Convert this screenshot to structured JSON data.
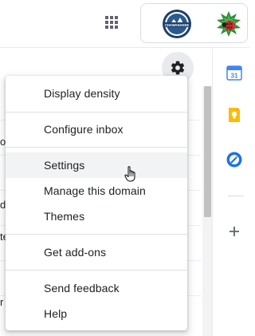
{
  "header": {
    "apps_icon": "apps-grid-icon",
    "org_logo_icon": "organization-logo",
    "org_logo_text": "CHAWANAKEE",
    "avatar_icon": "ladybug-avatar"
  },
  "list_fragments": [
    "o",
    "d",
    "te",
    "r"
  ],
  "side_panel": {
    "icons": [
      "calendar-icon",
      "keep-icon",
      "tasks-icon",
      "add-icon"
    ],
    "calendar_day": "31"
  },
  "settings_button": {
    "icon": "gear-icon"
  },
  "menu": {
    "items": [
      {
        "label": "Display density"
      },
      {
        "label": "Configure inbox"
      },
      {
        "label": "Settings"
      },
      {
        "label": "Manage this domain"
      },
      {
        "label": "Themes"
      },
      {
        "label": "Get add-ons"
      },
      {
        "label": "Send feedback"
      },
      {
        "label": "Help"
      }
    ],
    "hovered_item": "Settings"
  },
  "colors": {
    "calendar_blue": "#4285f4",
    "keep_yellow": "#fbbc04",
    "tasks_blue": "#1a73e8",
    "menu_hover": "#f1f3f4"
  }
}
